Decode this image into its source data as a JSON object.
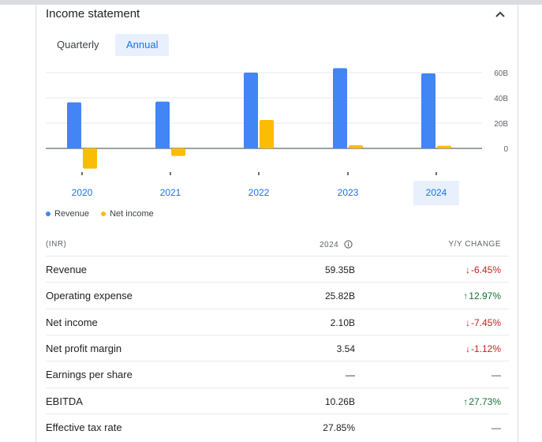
{
  "header": {
    "title": "Income statement"
  },
  "tabs": {
    "quarterly": "Quarterly",
    "annual": "Annual"
  },
  "chart_data": {
    "type": "bar",
    "categories": [
      "2020",
      "2021",
      "2022",
      "2023",
      "2024"
    ],
    "series": [
      {
        "name": "Revenue",
        "values": [
          36.5,
          37.0,
          60.0,
          63.5,
          59.35
        ],
        "color": "#4285f4"
      },
      {
        "name": "Net income",
        "values": [
          -16.0,
          -6.0,
          22.5,
          2.5,
          2.1
        ],
        "color": "#fbbc04"
      }
    ],
    "yticks": [
      "60B",
      "40B",
      "20B",
      "0"
    ],
    "ytick_values": [
      60,
      40,
      20,
      0
    ],
    "ylim": [
      -20,
      65
    ],
    "selected_category": "2024",
    "grid": true,
    "legend_placement": "bottom-left"
  },
  "legend": {
    "revenue": "Revenue",
    "net_income": "Net income"
  },
  "table": {
    "col_label": "(INR)",
    "col_year": "2024",
    "col_change": "Y/Y CHANGE",
    "rows": [
      {
        "label": "Revenue",
        "value": "59.35B",
        "change": "-6.45%",
        "dir": "down"
      },
      {
        "label": "Operating expense",
        "value": "25.82B",
        "change": "12.97%",
        "dir": "up"
      },
      {
        "label": "Net income",
        "value": "2.10B",
        "change": "-7.45%",
        "dir": "down"
      },
      {
        "label": "Net profit margin",
        "value": "3.54",
        "change": "-1.12%",
        "dir": "down"
      },
      {
        "label": "Earnings per share",
        "value": "—",
        "change": "—",
        "dir": "none"
      },
      {
        "label": "EBITDA",
        "value": "10.26B",
        "change": "27.73%",
        "dir": "up"
      },
      {
        "label": "Effective tax rate",
        "value": "27.85%",
        "change": "—",
        "dir": "none"
      }
    ]
  },
  "colors": {
    "revenue": "#4285f4",
    "net_income": "#fbbc04",
    "accent": "#1a73e8",
    "negative": "#c5221f",
    "positive": "#137333"
  }
}
